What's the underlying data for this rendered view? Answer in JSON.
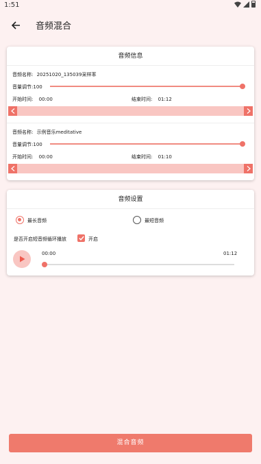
{
  "status": {
    "time": "1:51"
  },
  "app_bar": {
    "title": "音频混合"
  },
  "audio_info": {
    "title": "音频信息",
    "tracks": [
      {
        "name_label": "音频名称:",
        "name": "20251020_135039采样率",
        "volume_label": "音量调节:",
        "volume": "100",
        "start_label": "开始时间:",
        "start": "00:00",
        "end_label": "结束时间:",
        "end": "01:12"
      },
      {
        "name_label": "音频名称:",
        "name": "示例音乐meditative",
        "volume_label": "音量调节:",
        "volume": "100",
        "start_label": "开始时间:",
        "start": "00:00",
        "end_label": "结束时间:",
        "end": "01:10"
      }
    ]
  },
  "audio_settings": {
    "title": "音频设置",
    "options": [
      {
        "label": "最长音频",
        "selected": true
      },
      {
        "label": "最短音频",
        "selected": false
      }
    ],
    "loop_label": "是否开启短音频循环播放",
    "loop_checkbox_label": "开启",
    "loop_enabled": true,
    "player": {
      "current": "00:00",
      "total": "01:12",
      "progress": 0
    }
  },
  "mix_button": {
    "label": "混合音频"
  },
  "colors": {
    "accent": "#ef7268",
    "accent_light": "#f9c6c2",
    "background": "#fdf1f1"
  }
}
